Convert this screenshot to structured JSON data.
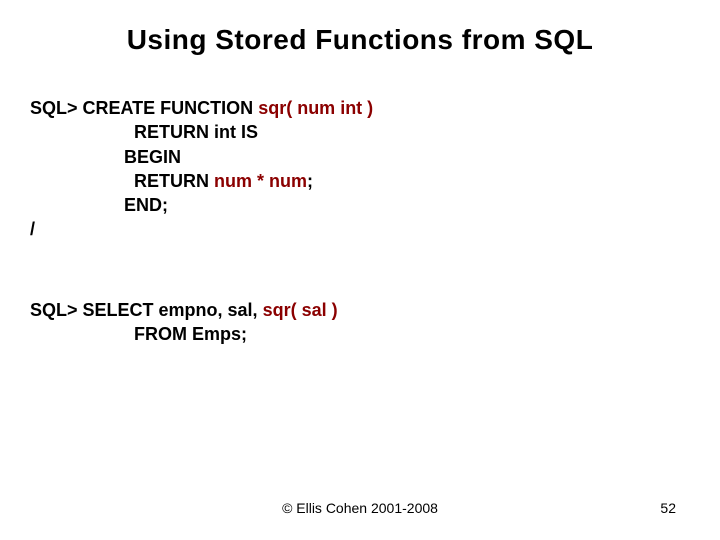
{
  "title": "Using Stored Functions from SQL",
  "block1": {
    "l1a": "SQL> CREATE FUNCTION ",
    "l1b": "sqr( num int )",
    "l2": "RETURN int IS",
    "l3": "BEGIN",
    "l4a": "RETURN ",
    "l4b": "num * num",
    "l4c": ";",
    "l5": "END;",
    "l6": "/"
  },
  "block2": {
    "l1a": "SQL> SELECT empno, sal, ",
    "l1b": "sqr( sal )",
    "l2": "FROM Emps;"
  },
  "footer": {
    "copyright": "© Ellis Cohen 2001-2008",
    "page": "52"
  }
}
